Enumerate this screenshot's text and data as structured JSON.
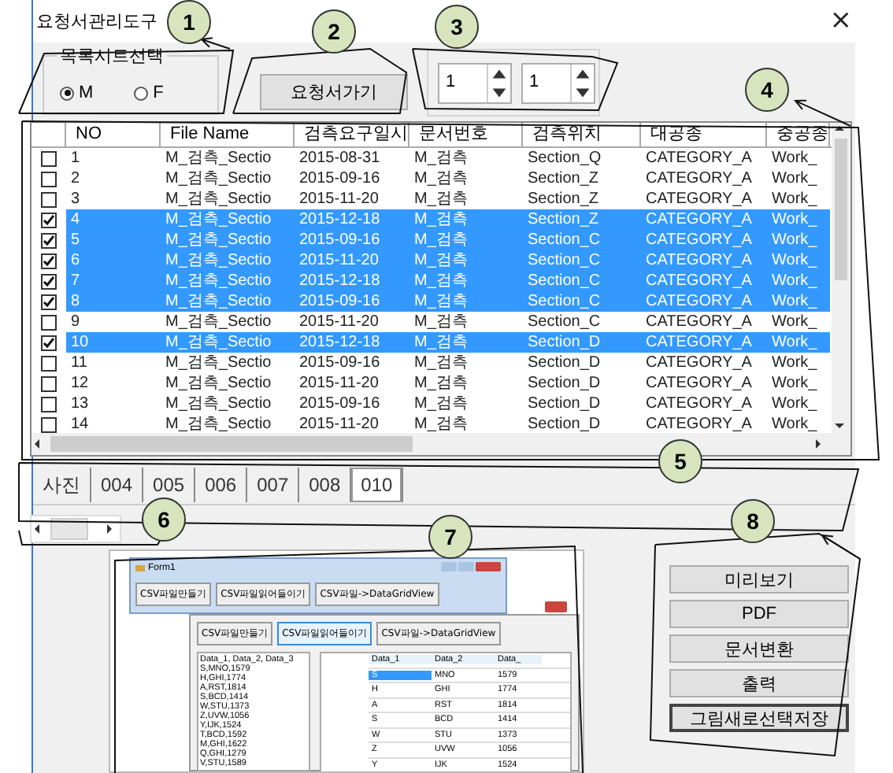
{
  "window": {
    "title": "요청서관리도구",
    "close": "×"
  },
  "sheet_group": {
    "title": "목록시트선택",
    "radios": [
      {
        "label": "M",
        "selected": true
      },
      {
        "label": "F",
        "selected": false
      }
    ]
  },
  "go_button": "요청서가기",
  "spinners": [
    {
      "value": "1"
    },
    {
      "value": "1"
    }
  ],
  "table": {
    "columns": [
      "NO",
      "File Name",
      "검측요구일시",
      "문서번호",
      "검측위치",
      "대공종",
      "중공종"
    ],
    "rows": [
      {
        "checked": false,
        "selected": false,
        "cells": [
          "1",
          "M_검측_Sectio",
          "2015-08-31",
          "M_검측",
          "Section_Q",
          "CATEGORY_A",
          "Work_"
        ]
      },
      {
        "checked": false,
        "selected": false,
        "cells": [
          "2",
          "M_검측_Sectio",
          "2015-09-16",
          "M_검측",
          "Section_Z",
          "CATEGORY_A",
          "Work_"
        ]
      },
      {
        "checked": false,
        "selected": false,
        "cells": [
          "3",
          "M_검측_Sectio",
          "2015-11-20",
          "M_검측",
          "Section_Z",
          "CATEGORY_A",
          "Work_"
        ]
      },
      {
        "checked": true,
        "selected": true,
        "cells": [
          "4",
          "M_검측_Sectio",
          "2015-12-18",
          "M_검측",
          "Section_Z",
          "CATEGORY_A",
          "Work_"
        ]
      },
      {
        "checked": true,
        "selected": true,
        "cells": [
          "5",
          "M_검측_Sectio",
          "2015-09-16",
          "M_검측",
          "Section_C",
          "CATEGORY_A",
          "Work_"
        ]
      },
      {
        "checked": true,
        "selected": true,
        "cells": [
          "6",
          "M_검측_Sectio",
          "2015-11-20",
          "M_검측",
          "Section_C",
          "CATEGORY_A",
          "Work_"
        ]
      },
      {
        "checked": true,
        "selected": true,
        "cells": [
          "7",
          "M_검측_Sectio",
          "2015-12-18",
          "M_검측",
          "Section_C",
          "CATEGORY_A",
          "Work_"
        ]
      },
      {
        "checked": true,
        "selected": true,
        "cells": [
          "8",
          "M_검측_Sectio",
          "2015-09-16",
          "M_검측",
          "Section_C",
          "CATEGORY_A",
          "Work_"
        ]
      },
      {
        "checked": false,
        "selected": false,
        "cells": [
          "9",
          "M_검측_Sectio",
          "2015-11-20",
          "M_검측",
          "Section_C",
          "CATEGORY_A",
          "Work_"
        ]
      },
      {
        "checked": true,
        "selected": true,
        "cells": [
          "10",
          "M_검측_Sectio",
          "2015-12-18",
          "M_검측",
          "Section_D",
          "CATEGORY_A",
          "Work_"
        ]
      },
      {
        "checked": false,
        "selected": false,
        "cells": [
          "11",
          "M_검측_Sectio",
          "2015-09-16",
          "M_검측",
          "Section_D",
          "CATEGORY_A",
          "Work_"
        ]
      },
      {
        "checked": false,
        "selected": false,
        "cells": [
          "12",
          "M_검측_Sectio",
          "2015-11-20",
          "M_검측",
          "Section_D",
          "CATEGORY_A",
          "Work_"
        ]
      },
      {
        "checked": false,
        "selected": false,
        "cells": [
          "13",
          "M_검측_Sectio",
          "2015-09-16",
          "M_검측",
          "Section_D",
          "CATEGORY_A",
          "Work_"
        ]
      },
      {
        "checked": false,
        "selected": false,
        "cells": [
          "14",
          "M_검측_Sectio",
          "2015-11-20",
          "M_검측",
          "Section_D",
          "CATEGORY_A",
          "Work_"
        ]
      }
    ]
  },
  "tabs": [
    {
      "label": "사진",
      "selected": false
    },
    {
      "label": "004",
      "selected": false
    },
    {
      "label": "005",
      "selected": false
    },
    {
      "label": "006",
      "selected": false
    },
    {
      "label": "007",
      "selected": false
    },
    {
      "label": "008",
      "selected": false
    },
    {
      "label": "010",
      "selected": true
    }
  ],
  "preview": {
    "front_window": {
      "title": "Form1",
      "buttons": [
        "CSV파일만들기",
        "CSV파일읽어들이기",
        "CSV파일->DataGridView"
      ]
    },
    "back_window": {
      "buttons": [
        {
          "label": "CSV파일만들기",
          "selected": false
        },
        {
          "label": "CSV파일읽어들이기",
          "selected": true
        },
        {
          "label": "CSV파일->DataGridView",
          "selected": false
        }
      ],
      "text_lines": [
        "Data_1, Data_2, Data_3",
        "S,MNO,1579",
        "H,GHI,1774",
        "A,RST,1814",
        "S,BCD,1414",
        "W,STU,1373",
        "Z,UVW,1056",
        "Y,IJK,1524",
        "T,BCD,1592",
        "M,GHI,1622",
        "Q,GHI,1279",
        "V,STU,1589"
      ],
      "grid": {
        "columns": [
          "Data_1",
          "Data_2",
          "Data_"
        ],
        "rows": [
          [
            "S",
            "MNO",
            "1579"
          ],
          [
            "H",
            "GHI",
            "1774"
          ],
          [
            "A",
            "RST",
            "1814"
          ],
          [
            "S",
            "BCD",
            "1414"
          ],
          [
            "W",
            "STU",
            "1373"
          ],
          [
            "Z",
            "UVW",
            "1056"
          ],
          [
            "Y",
            "IJK",
            "1524"
          ]
        ]
      }
    }
  },
  "actions": [
    {
      "label": "미리보기",
      "focused": false
    },
    {
      "label": "PDF",
      "focused": false
    },
    {
      "label": "문서변환",
      "focused": false
    },
    {
      "label": "출력",
      "focused": false
    },
    {
      "label": "그림새로선택저장",
      "focused": true
    }
  ],
  "callouts": [
    "1",
    "2",
    "3",
    "4",
    "5",
    "6",
    "7",
    "8"
  ]
}
